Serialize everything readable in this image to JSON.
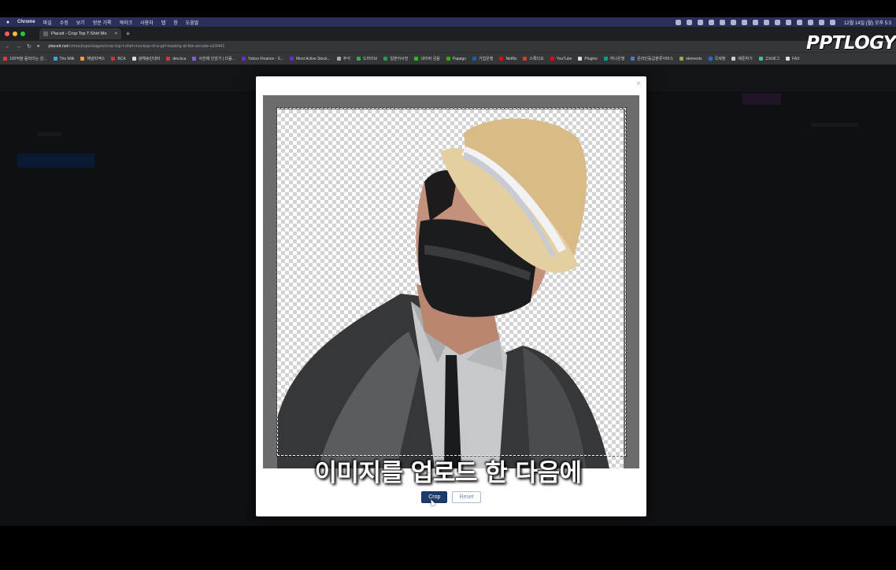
{
  "menubar": {
    "app": "Chrome",
    "items": [
      "파일",
      "수정",
      "보기",
      "방문 기록",
      "북마크",
      "사용자",
      "탭",
      "창",
      "도움말"
    ],
    "clock": "12월 14일 (월) 오후 5:3"
  },
  "browser": {
    "tab_title": "Placeit - Crop Top T-Shirt Mo",
    "new_tab": "+",
    "url_domain": "placeit.net",
    "url_path": "/c/mockups/stages/crop-top-t-shirt-mockup-of-a-girl-teasing-at-the-arcade-a19441",
    "bookmarks": [
      {
        "label": "100억을 움직이는 감...",
        "color": "#e03a3a"
      },
      {
        "label": "The Milk",
        "color": "#3aa5d8"
      },
      {
        "label": "해냄피엑스",
        "color": "#f0a030"
      },
      {
        "label": "BCA",
        "color": "#c33"
      },
      {
        "label": "광해송민네비",
        "color": "#ddd"
      },
      {
        "label": "dev.bca",
        "color": "#d33"
      },
      {
        "label": "사진에 인앙기 | 다음...",
        "color": "#8a5bd8"
      },
      {
        "label": "Yahoo Finance - S...",
        "color": "#6d2bd9"
      },
      {
        "label": "Most Active Stock...",
        "color": "#6d2bd9"
      },
      {
        "label": "주식",
        "color": "#aaa"
      },
      {
        "label": "드라이브",
        "color": "#34a853"
      },
      {
        "label": "일본어사전",
        "color": "#1aa34a"
      },
      {
        "label": "네이버 금융",
        "color": "#1ec800"
      },
      {
        "label": "Papago",
        "color": "#2db400"
      },
      {
        "label": "기업은행",
        "color": "#1b5fb5"
      },
      {
        "label": "Netflix",
        "color": "#e50914"
      },
      {
        "label": "스톡다요",
        "color": "#e33"
      },
      {
        "label": "YouTube",
        "color": "#f00"
      },
      {
        "label": "Plugins",
        "color": "#ddd"
      },
      {
        "label": "하나은행",
        "color": "#00a085"
      },
      {
        "label": "온라인등급분류서비스",
        "color": "#4a7bd0"
      },
      {
        "label": "elements",
        "color": "#82b541"
      },
      {
        "label": "국세청",
        "color": "#2a6bd0"
      },
      {
        "label": "배준하기",
        "color": "#ccc"
      },
      {
        "label": "고브로그",
        "color": "#3c8"
      },
      {
        "label": "FAX",
        "color": "#ddd"
      }
    ]
  },
  "overlay": {
    "logo": "PPTLOGY",
    "subtitle": "이미지를 업로드 한 다음에"
  },
  "modal": {
    "close": "×",
    "crop_label": "Crop",
    "reset_label": "Reset"
  }
}
